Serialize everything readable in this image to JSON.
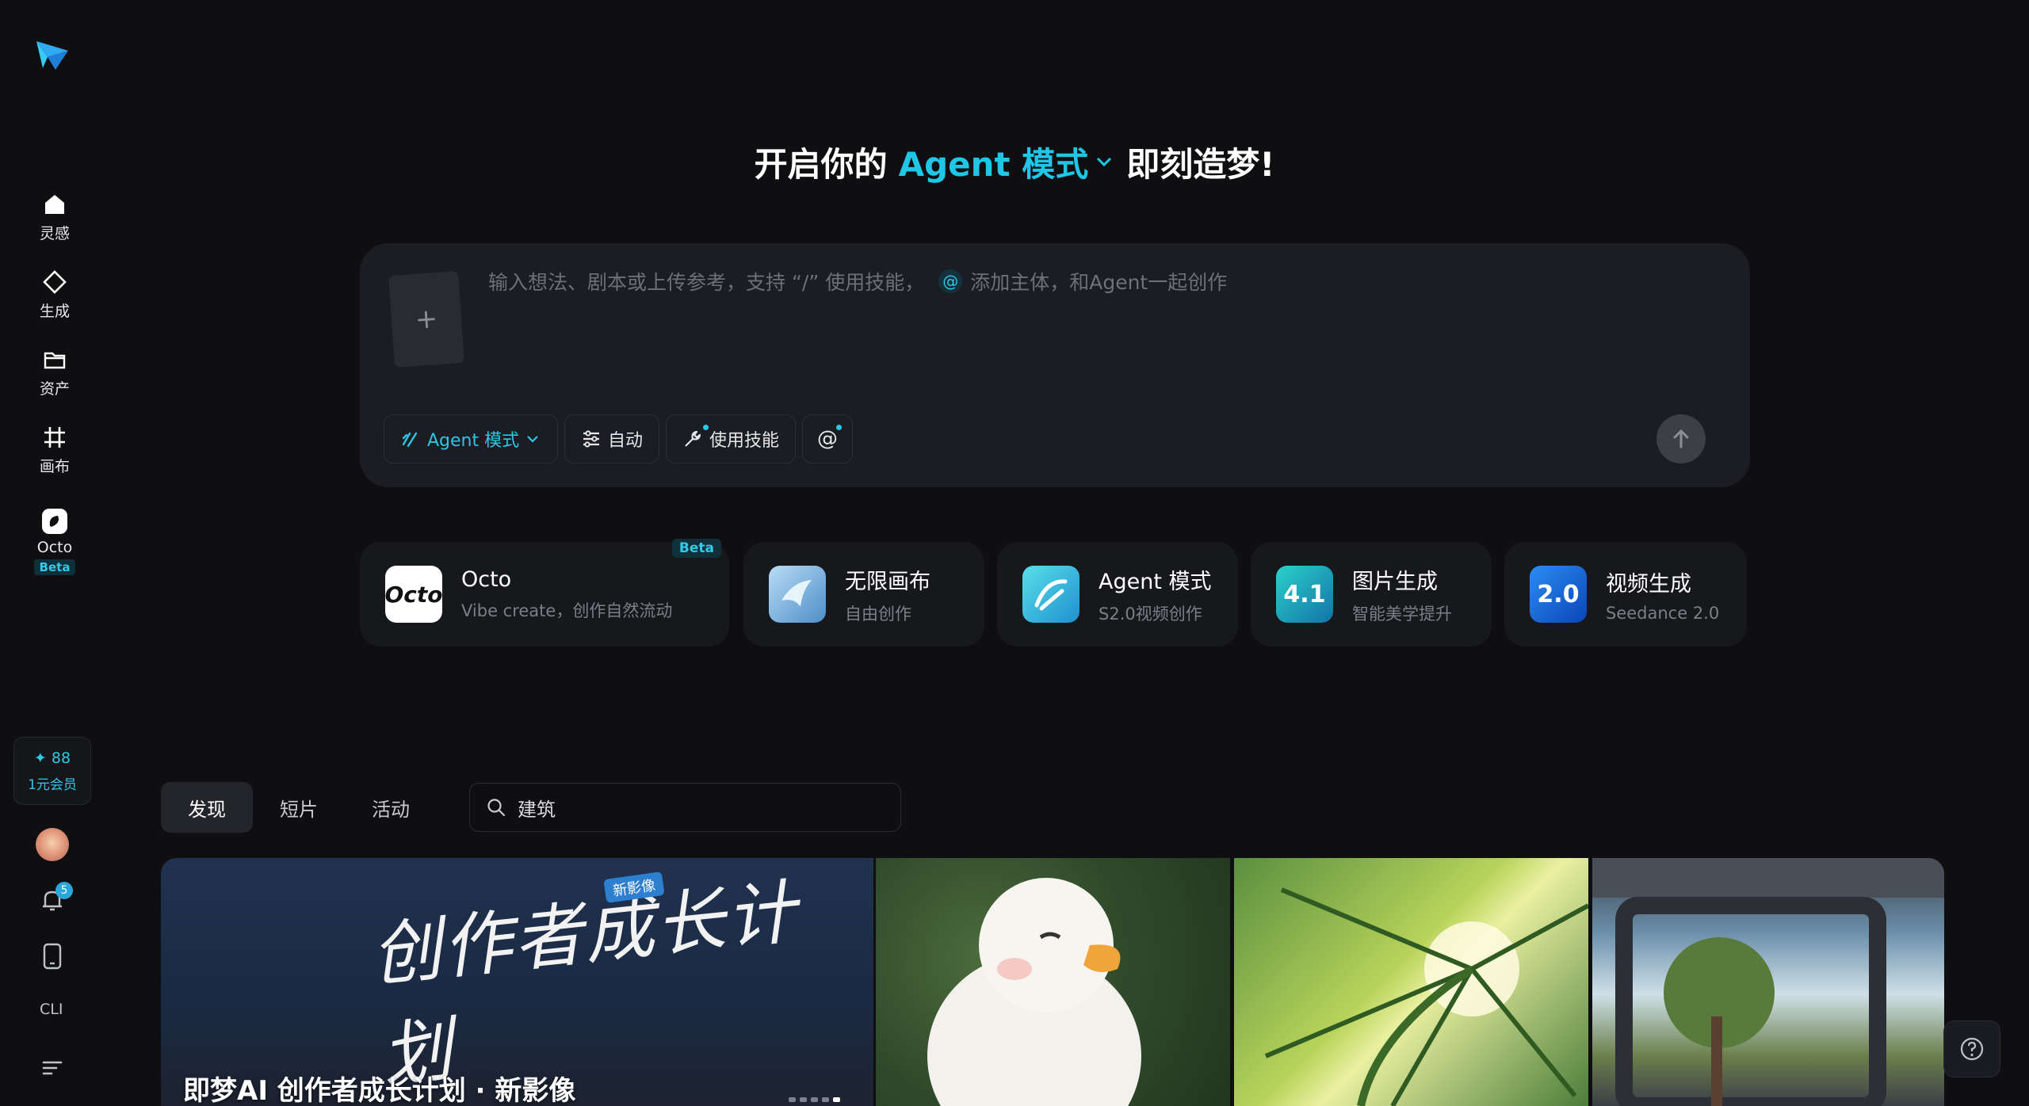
{
  "sidebar": {
    "items": [
      {
        "label": "灵感",
        "icon": "home-icon"
      },
      {
        "label": "生成",
        "icon": "sparkle-icon"
      },
      {
        "label": "资产",
        "icon": "folder-icon"
      },
      {
        "label": "画布",
        "icon": "canvas-icon"
      },
      {
        "label": "Octo",
        "icon": "octo-icon",
        "badge": "Beta"
      }
    ],
    "credits": {
      "amount": "✦ 88",
      "label": "1元会员"
    },
    "notification_count": "5",
    "cli_label": "CLI"
  },
  "hero": {
    "prefix": "开启你的",
    "mode": "Agent 模式",
    "suffix": "即刻造梦!"
  },
  "prompt": {
    "placeholder_main": "输入想法、剧本或上传参考，支持 “/” 使用技能，",
    "placeholder_tail": "添加主体，和Agent一起创作",
    "upload_symbol": "+",
    "tools": {
      "agent_mode": "Agent 模式",
      "auto": "自动",
      "skills": "使用技能",
      "mention": "@"
    }
  },
  "features": [
    {
      "title": "Octo",
      "subtitle": "Vibe create，创作自然流动",
      "badge": "Beta",
      "icon_text": "Octo"
    },
    {
      "title": "无限画布",
      "subtitle": "自由创作",
      "icon_text": ""
    },
    {
      "title": "Agent 模式",
      "subtitle": "S2.0视频创作",
      "icon_text": ""
    },
    {
      "title": "图片生成",
      "subtitle": "智能美学提升",
      "icon_text": "4.1"
    },
    {
      "title": "视频生成",
      "subtitle": "Seedance 2.0",
      "icon_text": "2.0"
    }
  ],
  "tabs": [
    "发现",
    "短片",
    "活动"
  ],
  "search": {
    "value": "建筑"
  },
  "gallery": {
    "banner_script": "创作者成长计划",
    "banner_tag": "新影像",
    "banner_caption": "即梦AI 创作者成长计划 · 新影像"
  },
  "colors": {
    "accent": "#1fc6e6",
    "background": "#0f0f12",
    "panel": "#1c1d22"
  }
}
